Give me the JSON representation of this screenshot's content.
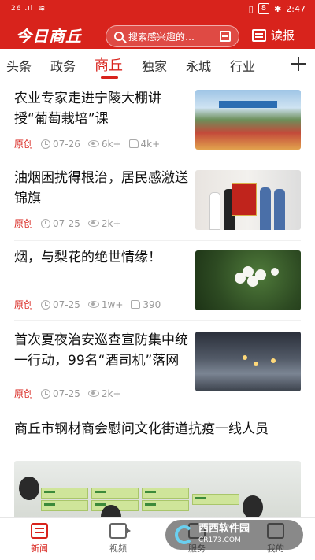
{
  "status_bar": {
    "signal": "26 .ıl",
    "battery": "8",
    "time": "2:47"
  },
  "header": {
    "logo": "今日商丘",
    "search_placeholder": "搜索感兴趣的…",
    "paper_label": "读报",
    "brand_color": "#d8231c"
  },
  "tabs": [
    {
      "label": "头条"
    },
    {
      "label": "政务"
    },
    {
      "label": "商丘",
      "active": true
    },
    {
      "label": "独家"
    },
    {
      "label": "永城"
    },
    {
      "label": "行业"
    }
  ],
  "articles": [
    {
      "title": "农业专家走进宁陵大棚讲授“葡萄栽培”课",
      "tag": "原创",
      "date": "07-26",
      "views": "6k+",
      "likes": "4k+"
    },
    {
      "title": "油烟困扰得根治，居民感激送锦旗",
      "tag": "原创",
      "date": "07-25",
      "views": "2k+",
      "likes": ""
    },
    {
      "title": "烟，与梨花的绝世情缘！",
      "tag": "原创",
      "date": "07-25",
      "views": "1w+",
      "likes": "390"
    },
    {
      "title": "首次夏夜治安巡查宣防集中统一行动，99名“酒司机”落网",
      "tag": "原创",
      "date": "07-25",
      "views": "2k+",
      "likes": ""
    },
    {
      "title": "商丘市钢材商会慰问文化街道抗疫一线人员"
    }
  ],
  "bottom_nav": [
    {
      "label": "新闻",
      "icon": "news-icon",
      "active": true
    },
    {
      "label": "视频",
      "icon": "video-icon"
    },
    {
      "label": "服务",
      "icon": "service-icon"
    },
    {
      "label": "我的",
      "icon": "profile-icon"
    }
  ],
  "watermark": {
    "name": "西西软件园",
    "url": "CR173.COM"
  }
}
